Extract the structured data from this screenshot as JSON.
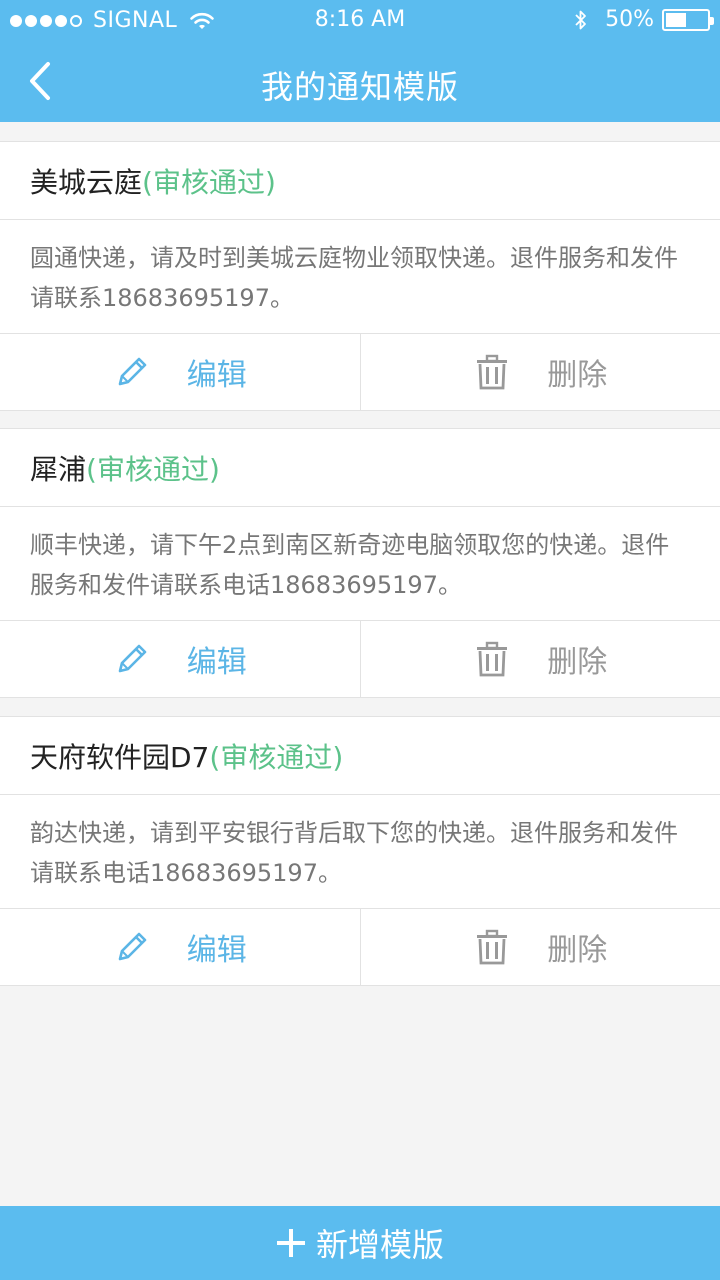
{
  "status_bar": {
    "carrier": "SIGNAL",
    "time": "8:16 AM",
    "battery_percent": "50%",
    "battery_level": 0.5
  },
  "nav": {
    "title": "我的通知模版"
  },
  "templates": [
    {
      "name": "美城云庭",
      "status": "(审核通过)",
      "content": "圆通快递，请及时到美城云庭物业领取快递。退件服务和发件请联系18683695197。",
      "edit_label": "编辑",
      "delete_label": "删除"
    },
    {
      "name": "犀浦",
      "status": "(审核通过)",
      "content": "顺丰快递，请下午2点到南区新奇迹电脑领取您的快递。退件服务和发件请联系电话18683695197。",
      "edit_label": "编辑",
      "delete_label": "删除"
    },
    {
      "name": "天府软件园D7",
      "status": "(审核通过)",
      "content": "韵达快递，请到平安银行背后取下您的快递。退件服务和发件请联系电话18683695197。",
      "edit_label": "编辑",
      "delete_label": "删除"
    }
  ],
  "add_button": {
    "label": "新增模版"
  },
  "colors": {
    "primary": "#5bbcef",
    "approved": "#5cc28a",
    "edit": "#5bb5e6",
    "delete": "#999999"
  },
  "icons": {
    "back": "chevron-left-icon",
    "edit": "pencil-icon",
    "delete": "trash-icon",
    "add": "plus-icon",
    "wifi": "wifi-icon",
    "bluetooth": "bluetooth-icon",
    "battery": "battery-icon"
  }
}
